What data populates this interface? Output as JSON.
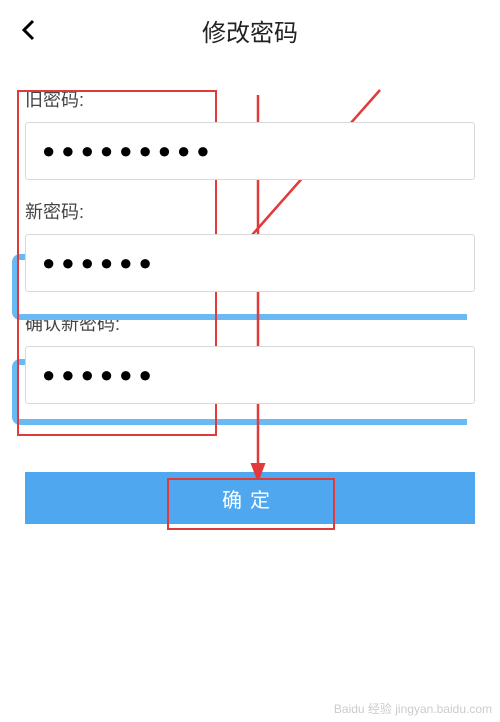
{
  "header": {
    "title": "修改密码"
  },
  "form": {
    "oldPassword": {
      "label": "旧密码:",
      "value": "●●●●●●●●●"
    },
    "newPassword": {
      "label": "新密码:",
      "value": "●●●●●●"
    },
    "confirmPassword": {
      "label": "确认新密码:",
      "value": "●●●●●●"
    }
  },
  "buttons": {
    "confirm": "确定"
  },
  "annotations": {
    "watermark": "Baidu 经验\njingyan.baidu.com"
  }
}
